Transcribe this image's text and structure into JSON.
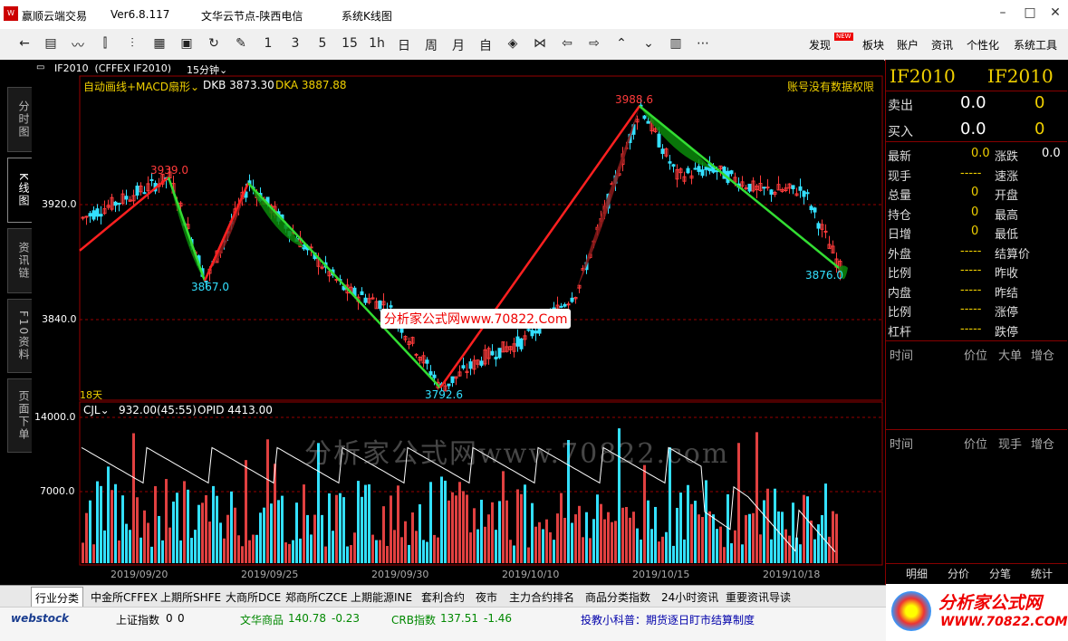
{
  "titlebar": {
    "app": "赢顺云端交易",
    "version": "Ver6.8.117",
    "node": "文华云节点-陕西电信",
    "view": "系统K线图"
  },
  "toolbar": {
    "tools": [
      "1",
      "3",
      "5",
      "15",
      "1h",
      "日",
      "周",
      "月",
      "自"
    ],
    "right_items": [
      "发现",
      "板块",
      "账户",
      "资讯",
      "个性化",
      "系统工具"
    ],
    "new_badge": "NEW"
  },
  "left_tabs": [
    "分时图",
    "K线图",
    "资讯链",
    "F10资料",
    "页面下单"
  ],
  "chart": {
    "symbol_line": "IF2010  (CFFEX IF2010)",
    "period": "15分钟",
    "indicator": "自动画线+MACD扇形",
    "dkb": "DKB 3873.30",
    "dka": "DKA 3887.88",
    "no_permission": "账号没有数据权限",
    "price_labels": [
      "3920.0",
      "3840.0"
    ],
    "annotations": [
      "3939.0",
      "3867.0",
      "3988.6",
      "3876.0",
      "3792.6"
    ],
    "watermark_small": "分析家公式网www.70822.Com",
    "watermark_big": "分析家公式网www.70822.com",
    "days": "18天",
    "vol_header": "CJL",
    "vol_value": "932.00(45:55)",
    "opid": "OPID 4413.00",
    "vol_labels": [
      "14000.0",
      "7000.0"
    ],
    "dates": [
      "2019/09/20",
      "2019/09/25",
      "2019/09/30",
      "2019/10/10",
      "2019/10/15",
      "2019/10/18"
    ]
  },
  "right_panel": {
    "codes": [
      "IF2010",
      "IF2010"
    ],
    "sell_label": "卖出",
    "sell_price": "0.0",
    "sell_vol": "0",
    "buy_label": "买入",
    "buy_price": "0.0",
    "buy_vol": "0",
    "quote_rows": [
      {
        "l": "最新",
        "lv": "0.0",
        "r": "涨跌",
        "rv": "0.0"
      },
      {
        "l": "现手",
        "lv": "-----",
        "r": "速涨",
        "rv": ""
      },
      {
        "l": "总量",
        "lv": "0",
        "r": "开盘",
        "rv": ""
      },
      {
        "l": "持仓",
        "lv": "0",
        "r": "最高",
        "rv": ""
      },
      {
        "l": "日增",
        "lv": "0",
        "r": "最低",
        "rv": ""
      },
      {
        "l": "外盘",
        "lv": "-----",
        "r": "结算价",
        "rv": ""
      },
      {
        "l": "比例",
        "lv": "-----",
        "r": "昨收",
        "rv": ""
      },
      {
        "l": "内盘",
        "lv": "-----",
        "r": "昨结",
        "rv": ""
      },
      {
        "l": "比例",
        "lv": "-----",
        "r": "涨停",
        "rv": ""
      },
      {
        "l": "杠杆",
        "lv": "-----",
        "r": "跌停",
        "rv": ""
      }
    ],
    "tick_header1": [
      "时间",
      "价位",
      "大单",
      "增仓"
    ],
    "tick_header2": [
      "时间",
      "价位",
      "现手",
      "增仓"
    ],
    "bottom_tabs": [
      "明细",
      "分价",
      "分笔",
      "统计"
    ]
  },
  "bottom_tabs": [
    "行业分类",
    "中金所CFFEX",
    "上期所SHFE",
    "大商所DCE",
    "郑商所CZCE",
    "上期能源INE",
    "套利合约",
    "夜市",
    "主力合约排名",
    "商品分类指数",
    "24小时资讯",
    "重要资讯导读"
  ],
  "statusbar": {
    "logo": "webstock",
    "sh_label": "上证指数",
    "sh_v1": "0",
    "sh_v2": "0",
    "wh_label": "文华商品",
    "wh_v1": "140.78",
    "wh_v2": "-0.23",
    "crb_label": "CRB指数",
    "crb_v1": "137.51",
    "crb_v2": "-1.46",
    "notice": "投教小科普：期货逐日盯市结算制度",
    "brand": "分析家公式网",
    "brand_url": "WWW.70822.COM"
  }
}
